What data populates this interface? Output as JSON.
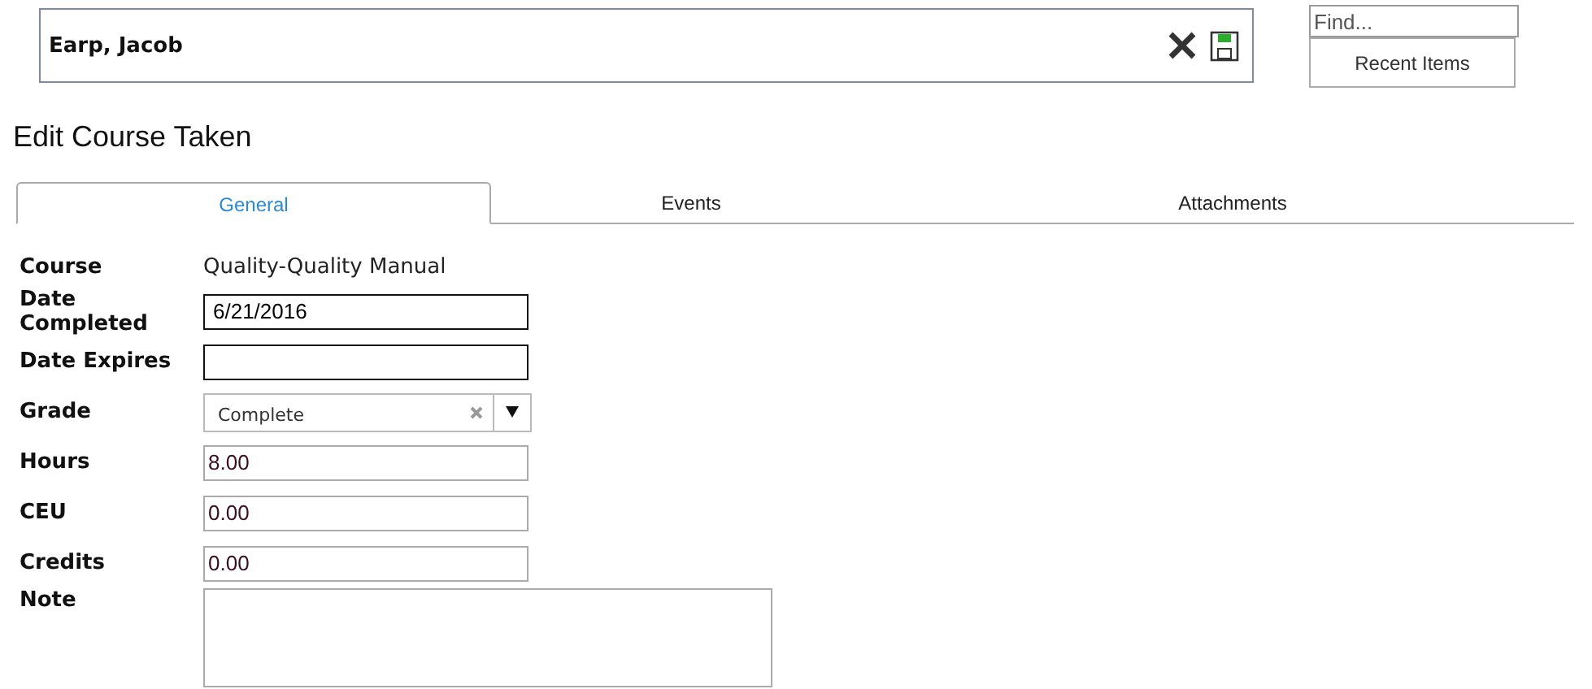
{
  "header": {
    "name": "Earp, Jacob"
  },
  "find": {
    "placeholder": "Find..."
  },
  "recent_button": "Recent Items",
  "title": "Edit Course Taken",
  "tabs": [
    {
      "label": "General",
      "selected": true
    },
    {
      "label": "Events",
      "selected": false
    },
    {
      "label": "Attachments",
      "selected": false
    }
  ],
  "fields": [
    {
      "label": "Course",
      "kind": "text",
      "value": "Quality-Quality Manual"
    },
    {
      "label": "Date Completed",
      "kind": "date",
      "value": "6/21/2016"
    },
    {
      "label": "Date Expires",
      "kind": "date"
    },
    {
      "label": "Grade",
      "kind": "select",
      "value": "Complete"
    },
    {
      "label": "Hours",
      "kind": "number",
      "value": "8.00"
    },
    {
      "label": "CEU",
      "kind": "number",
      "value": "0.00"
    },
    {
      "label": "Credits",
      "kind": "number",
      "value": "0.00"
    },
    {
      "label": "Note",
      "kind": "textarea"
    }
  ]
}
